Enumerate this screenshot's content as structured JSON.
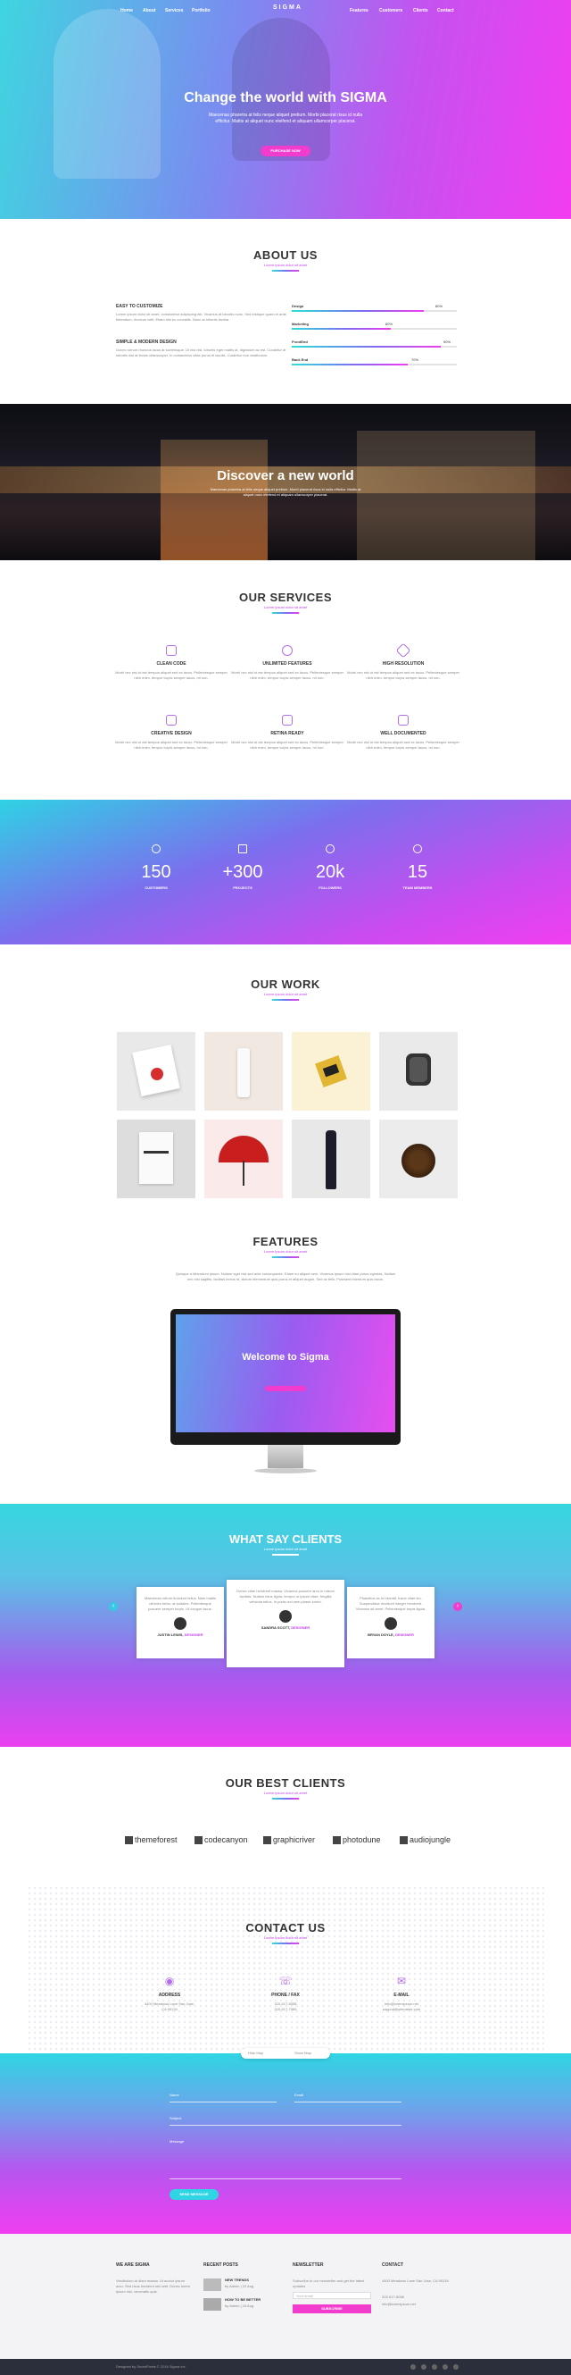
{
  "nav": {
    "items_left": [
      "Home",
      "About",
      "Services",
      "Portfolio"
    ],
    "items_right": [
      "Features",
      "Customers",
      "Clients",
      "Contact"
    ],
    "logo": "SIGMA"
  },
  "hero": {
    "title": "Change the world with SIGMA",
    "text": "Maecenas pharetra at felis neque aliquet pretium. Morbi placerat risus id nulla efficitur. Mattis at aliquet nunc eleifend et aliquam ullamcorper placerat.",
    "button": "PURCHASE NOW"
  },
  "about": {
    "title": "ABOUT US",
    "sub": "Lorem ipsum dolor sit amet",
    "blocks": [
      {
        "h": "EASY TO CUSTOMIZE",
        "p": "Lorem ipsum dolor sit amet, consectetur adipiscing elit. Vivamus at lobortis nunc. Sed tristique quam et ante bibendum, rhoncus velit. Etiam nisl ex convallis. Nunc at lobortis lacinia."
      },
      {
        "h": "SIMPLE & MODERN DESIGN",
        "p": "Donec rutrum rhoncus lacus at scelerisque. Ut nisl nisl, lobortis eget mattis at, dignissim ac est. Curabitur at lobortis nisl at lectus ullamcorper. In consectetur vitae purus et iaculis. Curabitur non vestibulum."
      }
    ],
    "skills": [
      {
        "name": "Design",
        "pct": "80%",
        "value": 0.8
      },
      {
        "name": "Marketing",
        "pct": "60%",
        "value": 0.6
      },
      {
        "name": "FrontEnd",
        "pct": "90%",
        "value": 0.9
      },
      {
        "name": "Back End",
        "pct": "70%",
        "value": 0.7
      }
    ]
  },
  "discover": {
    "title": "Discover a new world",
    "text": "Maecenas pharetra at felis neque aliquet pretium. Morbi placerat risus id nulla efficitur. Mattis at aliquet nunc eleifend et aliquam ullamcorper placerat."
  },
  "services": {
    "title": "OUR SERVICES",
    "sub": "Lorem ipsum dolor sit amet",
    "items": [
      {
        "t": "CLEAN CODE",
        "icon": "code-icon"
      },
      {
        "t": "UNLIMITED FEATURES",
        "icon": "fingerprint-icon"
      },
      {
        "t": "HIGH RESOLUTION",
        "icon": "diamond-icon"
      },
      {
        "t": "CREATIVE DESIGN",
        "icon": "layers-icon"
      },
      {
        "t": "RETINA READY",
        "icon": "monitor-icon"
      },
      {
        "t": "WELL DOCUMENTED",
        "icon": "book-icon"
      }
    ],
    "desc": "Morbi nec nisl ut est tempus aliquet sed ex lacus. Pellentesque semper nibh enim, tempor turpis semper lacus, mi non."
  },
  "counters": [
    {
      "n": "150",
      "l": "CUSTOMERS",
      "icon": "user-icon"
    },
    {
      "n": "+300",
      "l": "PROJECTS",
      "icon": "folder-icon"
    },
    {
      "n": "20k",
      "l": "FOLLOWERS",
      "icon": "cloud-icon"
    },
    {
      "n": "15",
      "l": "TEAM MEMBERS",
      "icon": "bulb-icon"
    }
  ],
  "work": {
    "title": "OUR WORK",
    "sub": "Lorem ipsum dolor sit amet"
  },
  "features": {
    "title": "FEATURES",
    "sub": "Lorem ipsum dolor sit amet",
    "text": "Quisque a bibendum ipsum. Nullam eget nisi sed ante consequente. Etiam eu aliquet sem. Vivamus ipsum nisi vitae purus egestas. Nullam nec nisl sagittis, facilisis lectus id, dictum elementum quis purus et aliquet augue. Sed ac felis. Praesent interdum quis lacus.",
    "screen_title": "Welcome to Sigma"
  },
  "testimonials": {
    "title": "WHAT SAY CLIENTS",
    "sub": "Lorem ipsum dolor sit amet",
    "items": [
      {
        "q": "Maecenas rutrum tincidunt tellus. Nam mattis ultricies tortor, at sodales. Pellentesque posuere semper turpis. Ut congue lacus.",
        "name": "JUSTIN LEWIS, ",
        "role": "DESIGNER"
      },
      {
        "q": "Donec vitae hendrerit massa. Vivamus posuere arcu in rutrum facilisis. Nullam risus ligula, tempor ut ipsum vitae, fringilla vehicula tellus. In porta orci sem phase lorum.",
        "name": "SANDRA SCOTT, ",
        "role": "DESIGNER"
      },
      {
        "q": "Phasellus ac ex blandit, fusce vitae leo. Suspendisse tincidunt integer hendrerit. Vivamus sit amet. Pellentesque turpis ligula.",
        "name": "BRYAN DOYLE, ",
        "role": "DESIGNER"
      }
    ]
  },
  "partners": {
    "title": "OUR BEST CLIENTS",
    "sub": "Lorem ipsum dolor sit amet",
    "items": [
      "themeforest",
      "codecanyon",
      "graphicriver",
      "photodune",
      "audiojungle"
    ]
  },
  "contact": {
    "title": "CONTACT US",
    "sub": "Lorem ipsum dolor sit amet",
    "cols": [
      {
        "h": "ADDRESS",
        "d1": "4400 Meadows Lane San Jose,",
        "d2": "CA 95134",
        "icon": "pin-icon"
      },
      {
        "h": "PHONE / FAX",
        "d1": "315-917-8058",
        "d2": "315-917-7989",
        "icon": "phone-icon"
      },
      {
        "h": "E-MAIL",
        "d1": "info@loremipsum.net",
        "d2": "support@sitename.com",
        "icon": "mail-icon"
      }
    ],
    "tabs": [
      "Hide Map",
      "Show Map"
    ],
    "form": {
      "name": "Name",
      "email": "Email",
      "subject": "Subject",
      "message": "Message",
      "send": "SEND MESSAGE"
    }
  },
  "footer": {
    "about_h": "WE ARE SIGMA",
    "about_t": "Vestibulum at diam massa. Ut auctor ipsum arcu. Sed risus tincidunt nisi velit. Donec lorem ipsum nisl, venenatis quis.",
    "posts_h": "RECENT POSTS",
    "posts": [
      {
        "t": "NEW TRENDS",
        "d": "by Admin | 22 Aug"
      },
      {
        "t": "HOW TO BE BETTER",
        "d": "by Admin | 15 Aug"
      }
    ],
    "news_h": "NEWSLETTER",
    "news_t": "Subscribe to our newsletter and get the latest updates",
    "news_ph": "Your email",
    "news_btn": "SUBSCRIBE",
    "contact_h": "CONTACT",
    "contact_t1": "4400 Meadows Lane San Jose, CA 95134",
    "contact_t2": "315-917-8058",
    "contact_t3": "info@loremipsum.net",
    "copy": "Designed by SmartPixels © 2018 Sigma Inc."
  }
}
